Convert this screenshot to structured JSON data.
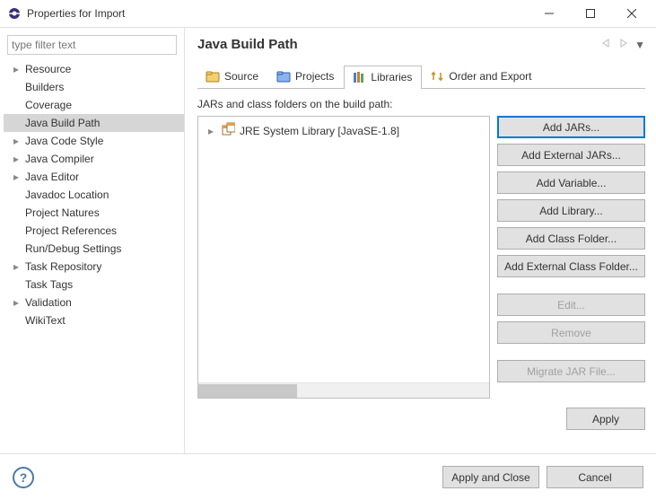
{
  "window": {
    "title": "Properties for Import"
  },
  "sidebar": {
    "filter_placeholder": "type filter text",
    "items": [
      {
        "label": "Resource",
        "expandable": true,
        "selected": false
      },
      {
        "label": "Builders",
        "expandable": false,
        "selected": false
      },
      {
        "label": "Coverage",
        "expandable": false,
        "selected": false
      },
      {
        "label": "Java Build Path",
        "expandable": false,
        "selected": true
      },
      {
        "label": "Java Code Style",
        "expandable": true,
        "selected": false
      },
      {
        "label": "Java Compiler",
        "expandable": true,
        "selected": false
      },
      {
        "label": "Java Editor",
        "expandable": true,
        "selected": false
      },
      {
        "label": "Javadoc Location",
        "expandable": false,
        "selected": false
      },
      {
        "label": "Project Natures",
        "expandable": false,
        "selected": false
      },
      {
        "label": "Project References",
        "expandable": false,
        "selected": false
      },
      {
        "label": "Run/Debug Settings",
        "expandable": false,
        "selected": false
      },
      {
        "label": "Task Repository",
        "expandable": true,
        "selected": false
      },
      {
        "label": "Task Tags",
        "expandable": false,
        "selected": false
      },
      {
        "label": "Validation",
        "expandable": true,
        "selected": false
      },
      {
        "label": "WikiText",
        "expandable": false,
        "selected": false
      }
    ]
  },
  "main": {
    "heading": "Java Build Path",
    "tabs": [
      {
        "label": "Source",
        "icon": "source-folder-icon"
      },
      {
        "label": "Projects",
        "icon": "projects-folder-icon"
      },
      {
        "label": "Libraries",
        "icon": "libraries-icon"
      },
      {
        "label": "Order and Export",
        "icon": "order-export-icon"
      }
    ],
    "active_tab_index": 2,
    "description": "JARs and class folders on the build path:",
    "library_entry": "JRE System Library [JavaSE-1.8]",
    "buttons": {
      "add_jars": "Add JARs...",
      "add_ext_jars": "Add External JARs...",
      "add_var": "Add Variable...",
      "add_lib": "Add Library...",
      "add_cf": "Add Class Folder...",
      "add_ext_cf": "Add External Class Folder...",
      "edit": "Edit...",
      "remove": "Remove",
      "migrate": "Migrate JAR File..."
    },
    "apply": "Apply"
  },
  "footer": {
    "apply_close": "Apply and Close",
    "cancel": "Cancel"
  }
}
